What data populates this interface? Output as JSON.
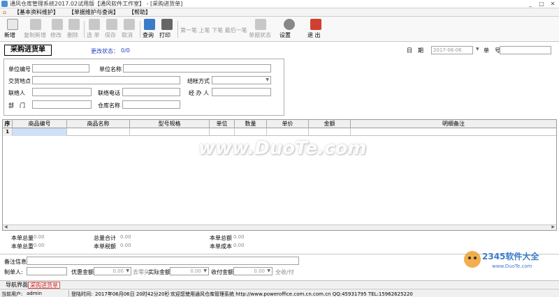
{
  "window": {
    "title": "通风仓库管理系统2017.02试用版【通风软件工作室】 - [采购进货单]",
    "min": "_",
    "restore": "□",
    "close": "✕"
  },
  "menu": {
    "items": [
      "【基本资料维护】",
      "【单据维护与查询】",
      "【帮助】"
    ]
  },
  "toolbar": {
    "new": "新增",
    "copy_new": "复制新增",
    "edit": "修改",
    "delete": "删除",
    "select": "选 单",
    "save": "保存",
    "cancel": "取消",
    "query": "查询",
    "print": "打印",
    "nav_text": "第一笔  上笔  下笔  最后一笔",
    "doc_status": "单据状态",
    "settings": "设置",
    "exit": "退 出"
  },
  "form": {
    "title": "采购进货单",
    "status_label": "更改状态：",
    "status_value": "0/0",
    "date_label": "日　期",
    "date_value": "2017-06-06",
    "docno_label": "单　号",
    "unit_code_label": "单位编号",
    "unit_name_label": "单位名称",
    "delivery_label": "交货地点",
    "settle_label": "结帐方式",
    "contact_label": "联络人",
    "phone_label": "联络电话",
    "handler_label": "经 办 人",
    "dept_label": "部　门",
    "warehouse_label": "仓库名称"
  },
  "grid": {
    "columns": [
      "序",
      "商品编号",
      "商品名称",
      "型号规格",
      "单位",
      "数量",
      "单价",
      "金额",
      "明细备注"
    ],
    "rows": [
      [
        "1",
        "",
        "",
        "",
        "",
        "",
        "",
        "",
        ""
      ]
    ]
  },
  "totals": {
    "total_qty_label": "本单总量",
    "total_qty": "0.00",
    "total_sum_label": "总量合计",
    "total_sum": "0.00",
    "total_amount_label": "本单总额",
    "total_amount": "0.00",
    "total_weight_label": "本单总重",
    "total_weight": "0.00",
    "tax_amount_label": "本单税额",
    "tax_amount": "0.00",
    "cost_label": "本单成本",
    "cost": "0.00"
  },
  "footer": {
    "remark_label": "备注信息",
    "maker_label": "制单人:",
    "discount_label": "优惠金额",
    "discount_value": "0.00",
    "rounding_text": "去零头",
    "actual_label": "实际金额",
    "actual_value": "0.00",
    "paid_label": "收付金额",
    "paid_value": "0.00",
    "all_paid_text": "全收/付"
  },
  "nav": {
    "tabs": [
      "导航界面",
      "采购进货单"
    ]
  },
  "status": {
    "user_label": "当前用户:",
    "user": "admin",
    "login_label": "登陆时间:",
    "login_time": "2017年06月06日 20时42分20秒",
    "welcome": "欢迎您使用通风仓库管理系统 http://www.poweroffice.com.cn.com.cn QQ:45931795 TEL:15962625220"
  },
  "watermark": {
    "text": "www.DuoTe.com",
    "logo_text": "2345软件大全",
    "logo_url": "www.DuoTe.com"
  },
  "colors": {
    "accent": "#2040c0",
    "active_tab": "#c02020",
    "selected_cell": "#cfe0f8"
  }
}
